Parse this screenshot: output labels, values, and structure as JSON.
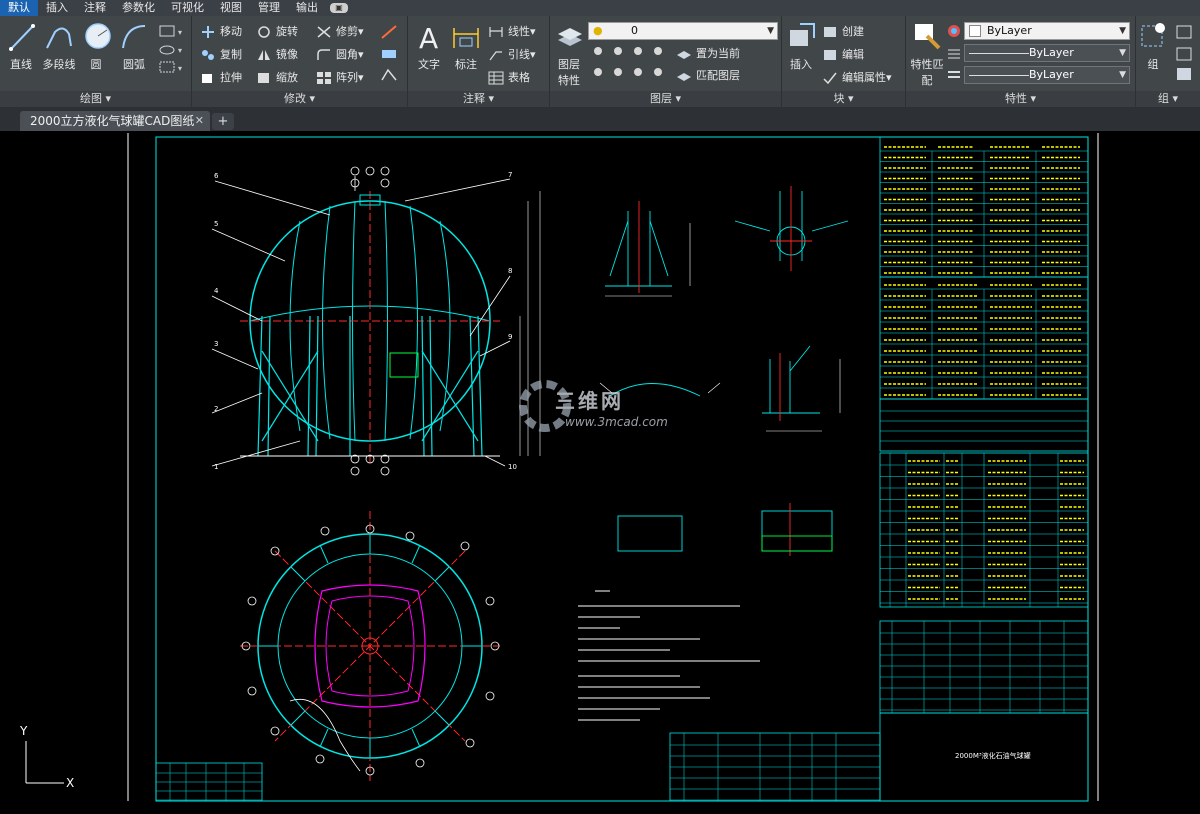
{
  "menu": {
    "tabs": [
      "默认",
      "插入",
      "注释",
      "参数化",
      "可视化",
      "视图",
      "管理",
      "输出"
    ],
    "active_index": 0
  },
  "ribbon": {
    "draw": {
      "title": "绘图",
      "line": "直线",
      "polyline": "多段线",
      "circle": "圆",
      "arc": "圆弧"
    },
    "modify": {
      "title": "修改",
      "move": "移动",
      "rotate": "旋转",
      "trim": "修剪",
      "copy": "复制",
      "mirror": "镜像",
      "fillet": "圆角",
      "stretch": "拉伸",
      "scale": "缩放",
      "array": "阵列"
    },
    "annotation": {
      "title": "注释",
      "text": "文字",
      "dimension": "标注",
      "linear": "线性",
      "leader": "引线",
      "table": "表格"
    },
    "layers": {
      "title": "图层",
      "layer_properties": "图层特性",
      "current_layer": "0",
      "set_current": "置为当前",
      "match_layer": "匹配图层"
    },
    "block": {
      "title": "块",
      "insert": "插入",
      "create": "创建",
      "edit": "编辑",
      "edit_attributes": "编辑属性"
    },
    "properties": {
      "title": "特性",
      "match": "特性匹配",
      "color": "ByLayer",
      "linetype": "ByLayer",
      "lineweight": "ByLayer"
    },
    "groups": {
      "title": "组",
      "group": "组"
    }
  },
  "document": {
    "tab_title": "2000立方液化气球罐CAD图纸",
    "new_tab": "+"
  },
  "watermark": {
    "brand": "三维网",
    "url": "www.3mcad.com"
  },
  "drawing": {
    "title_block": "2000M³液化石油气球罐"
  },
  "ucs": {
    "x": "X",
    "y": "Y"
  },
  "colors": {
    "accent": "#1b62b0",
    "cyan": "#00e6e6",
    "red": "#ff2a2a",
    "yellow": "#ffff00",
    "magenta": "#ff00ff",
    "green": "#00ff40"
  }
}
